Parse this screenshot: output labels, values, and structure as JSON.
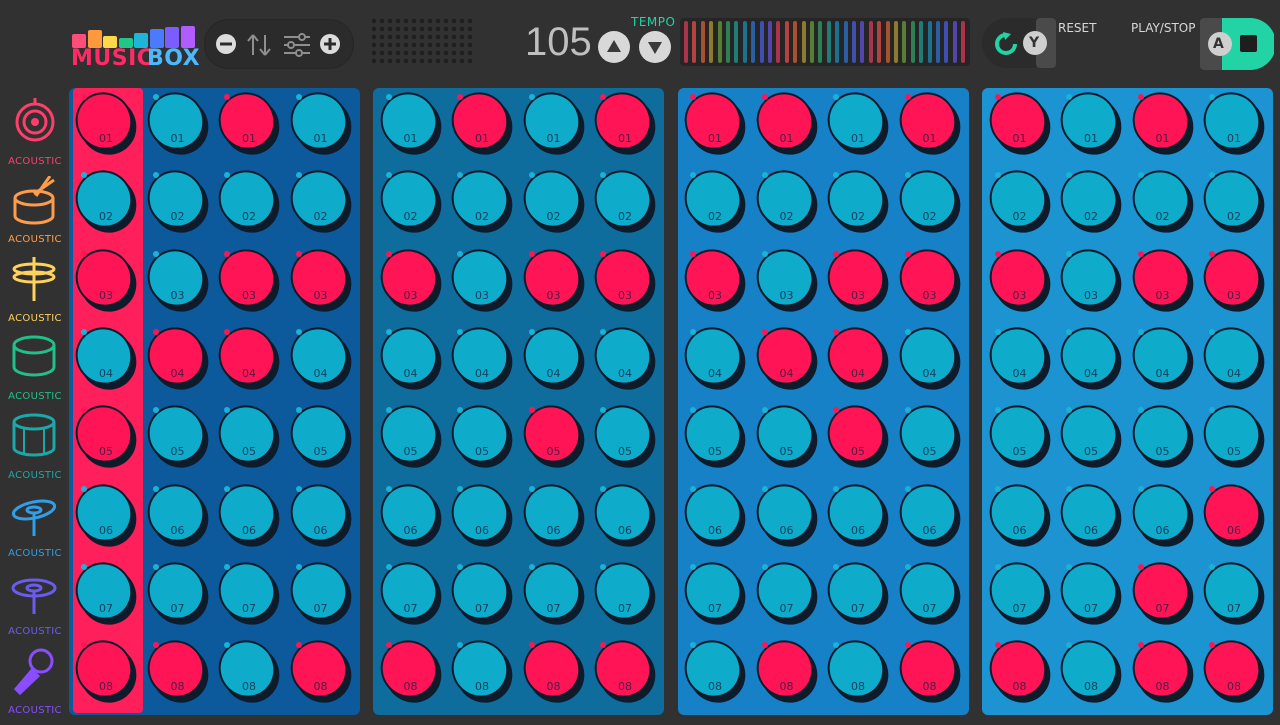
{
  "logo": {
    "word1": "MUSIC",
    "word2": "BOX",
    "bar_colors": [
      "#ff4d7a",
      "#ff9a3c",
      "#ffd84a",
      "#20c68a",
      "#1fb5d9",
      "#4a7bff",
      "#7a5cff",
      "#b05cff"
    ]
  },
  "controls": {
    "icons": [
      "minus-icon",
      "sort-icon",
      "sliders-icon",
      "plus-icon"
    ]
  },
  "tempo": {
    "value": "105",
    "label": "TEMPO",
    "up_icon": "triangle-up-icon",
    "down_icon": "triangle-down-icon"
  },
  "meter": {
    "colors": [
      "#a9344c",
      "#b5423e",
      "#a8512f",
      "#8d7a2e",
      "#567e34",
      "#2e7f54",
      "#1f7c76",
      "#1b7190",
      "#2a5fa2",
      "#3e4fb0",
      "#5246ad",
      "#a9344c",
      "#b5423e",
      "#a8512f",
      "#8d7a2e",
      "#567e34",
      "#2e7f54",
      "#1f7c76",
      "#1b7190",
      "#2a5fa2",
      "#3e4fb0",
      "#5246ad",
      "#a9344c",
      "#b5423e",
      "#a8512f",
      "#8d7a2e",
      "#567e34",
      "#2e7f54",
      "#1f7c76",
      "#1b7190",
      "#2a5fa2",
      "#3e4fb0",
      "#5246ad",
      "#a9344c"
    ]
  },
  "buttons": {
    "reset_label": "RESET",
    "reset_key": "Y",
    "play_label": "PLAY/STOP",
    "play_key": "A"
  },
  "colors": {
    "pad_on": "#ff1556",
    "pad_off": "#0eabca",
    "accent": "#22d3a6",
    "panels": [
      "#0c5a9b",
      "#0f6d9e",
      "#1781c7",
      "#1d94d2"
    ]
  },
  "sidebar": {
    "items": [
      {
        "label": "ACOUSTIC",
        "icon": "target-drum-icon",
        "color": "#ff3e6c"
      },
      {
        "label": "ACOUSTIC",
        "icon": "snare-drum-icon",
        "color": "#ff9c4a"
      },
      {
        "label": "ACOUSTIC",
        "icon": "hihat-icon",
        "color": "#ffd25a"
      },
      {
        "label": "ACOUSTIC",
        "icon": "tom-drum-icon",
        "color": "#20c08a"
      },
      {
        "label": "ACOUSTIC",
        "icon": "floor-tom-icon",
        "color": "#1aa9a8"
      },
      {
        "label": "ACOUSTIC",
        "icon": "crash-cymbal-icon",
        "color": "#2e9fe8"
      },
      {
        "label": "ACOUSTIC",
        "icon": "ride-cymbal-icon",
        "color": "#6a5cf0"
      },
      {
        "label": "ACOUSTIC",
        "icon": "microphone-icon",
        "color": "#8a4dff"
      }
    ]
  },
  "grid": {
    "row_labels": [
      "01",
      "02",
      "03",
      "04",
      "05",
      "06",
      "07",
      "08"
    ],
    "current_step": 1,
    "pattern": [
      [
        1,
        0,
        1,
        0,
        0,
        1,
        0,
        1,
        1,
        1,
        0,
        1,
        1,
        0,
        1,
        0
      ],
      [
        0,
        0,
        0,
        0,
        0,
        0,
        0,
        0,
        0,
        0,
        0,
        0,
        0,
        0,
        0,
        0
      ],
      [
        1,
        0,
        1,
        1,
        1,
        0,
        1,
        1,
        1,
        0,
        1,
        1,
        1,
        0,
        1,
        1
      ],
      [
        0,
        1,
        1,
        0,
        0,
        0,
        0,
        0,
        0,
        1,
        1,
        0,
        0,
        0,
        0,
        0
      ],
      [
        1,
        0,
        0,
        0,
        0,
        0,
        1,
        0,
        0,
        0,
        1,
        0,
        0,
        0,
        0,
        0
      ],
      [
        0,
        0,
        0,
        0,
        0,
        0,
        0,
        0,
        0,
        0,
        0,
        0,
        0,
        0,
        0,
        1
      ],
      [
        0,
        0,
        0,
        0,
        0,
        0,
        0,
        0,
        0,
        0,
        0,
        0,
        0,
        0,
        1,
        0
      ],
      [
        1,
        1,
        0,
        1,
        1,
        0,
        1,
        1,
        0,
        1,
        0,
        1,
        1,
        0,
        1,
        1
      ]
    ]
  }
}
